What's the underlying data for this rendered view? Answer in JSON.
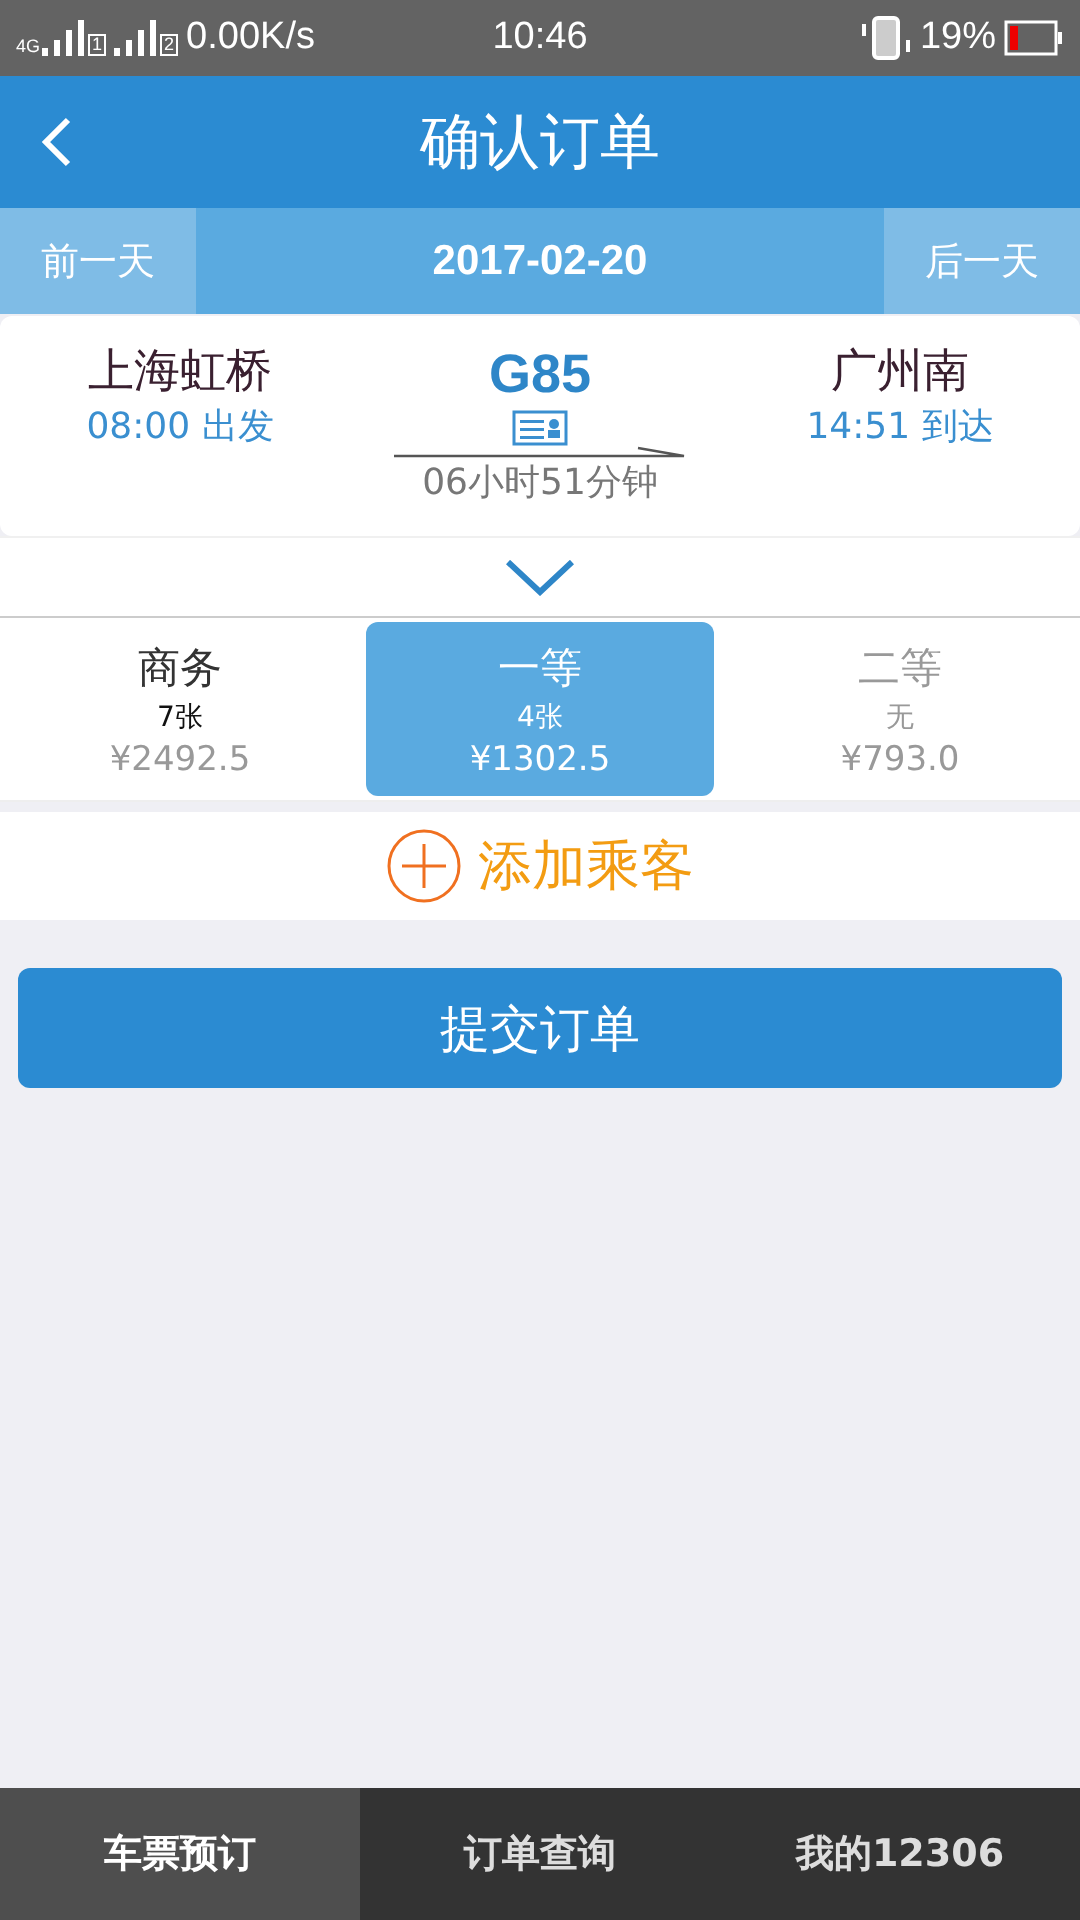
{
  "status_bar": {
    "network": "4G",
    "sims": [
      {
        "label": "1"
      },
      {
        "label": "2"
      }
    ],
    "speed": "0.00K/s",
    "time": "10:46",
    "battery": "19%"
  },
  "header": {
    "title": "确认订单"
  },
  "date_bar": {
    "prev": "前一天",
    "date": "2017-02-20",
    "next": "后一天"
  },
  "train": {
    "from": "上海虹桥",
    "depart": "08:00 出发",
    "number": "G85",
    "duration": "06小时51分钟",
    "to": "广州南",
    "arrive": "14:51 到达"
  },
  "seats": [
    {
      "name": "商务",
      "count": "7张",
      "price": "¥2492.5",
      "selected": false,
      "available": true
    },
    {
      "name": "一等",
      "count": "4张",
      "price": "¥1302.5",
      "selected": true,
      "available": true
    },
    {
      "name": "二等",
      "count": "无",
      "price": "¥793.0",
      "selected": false,
      "available": false
    }
  ],
  "add_passenger": "添加乘客",
  "submit": "提交订单",
  "nav": [
    {
      "label": "车票预订",
      "selected": true
    },
    {
      "label": "订单查询",
      "selected": false
    },
    {
      "label": "我的12306",
      "selected": false
    }
  ]
}
